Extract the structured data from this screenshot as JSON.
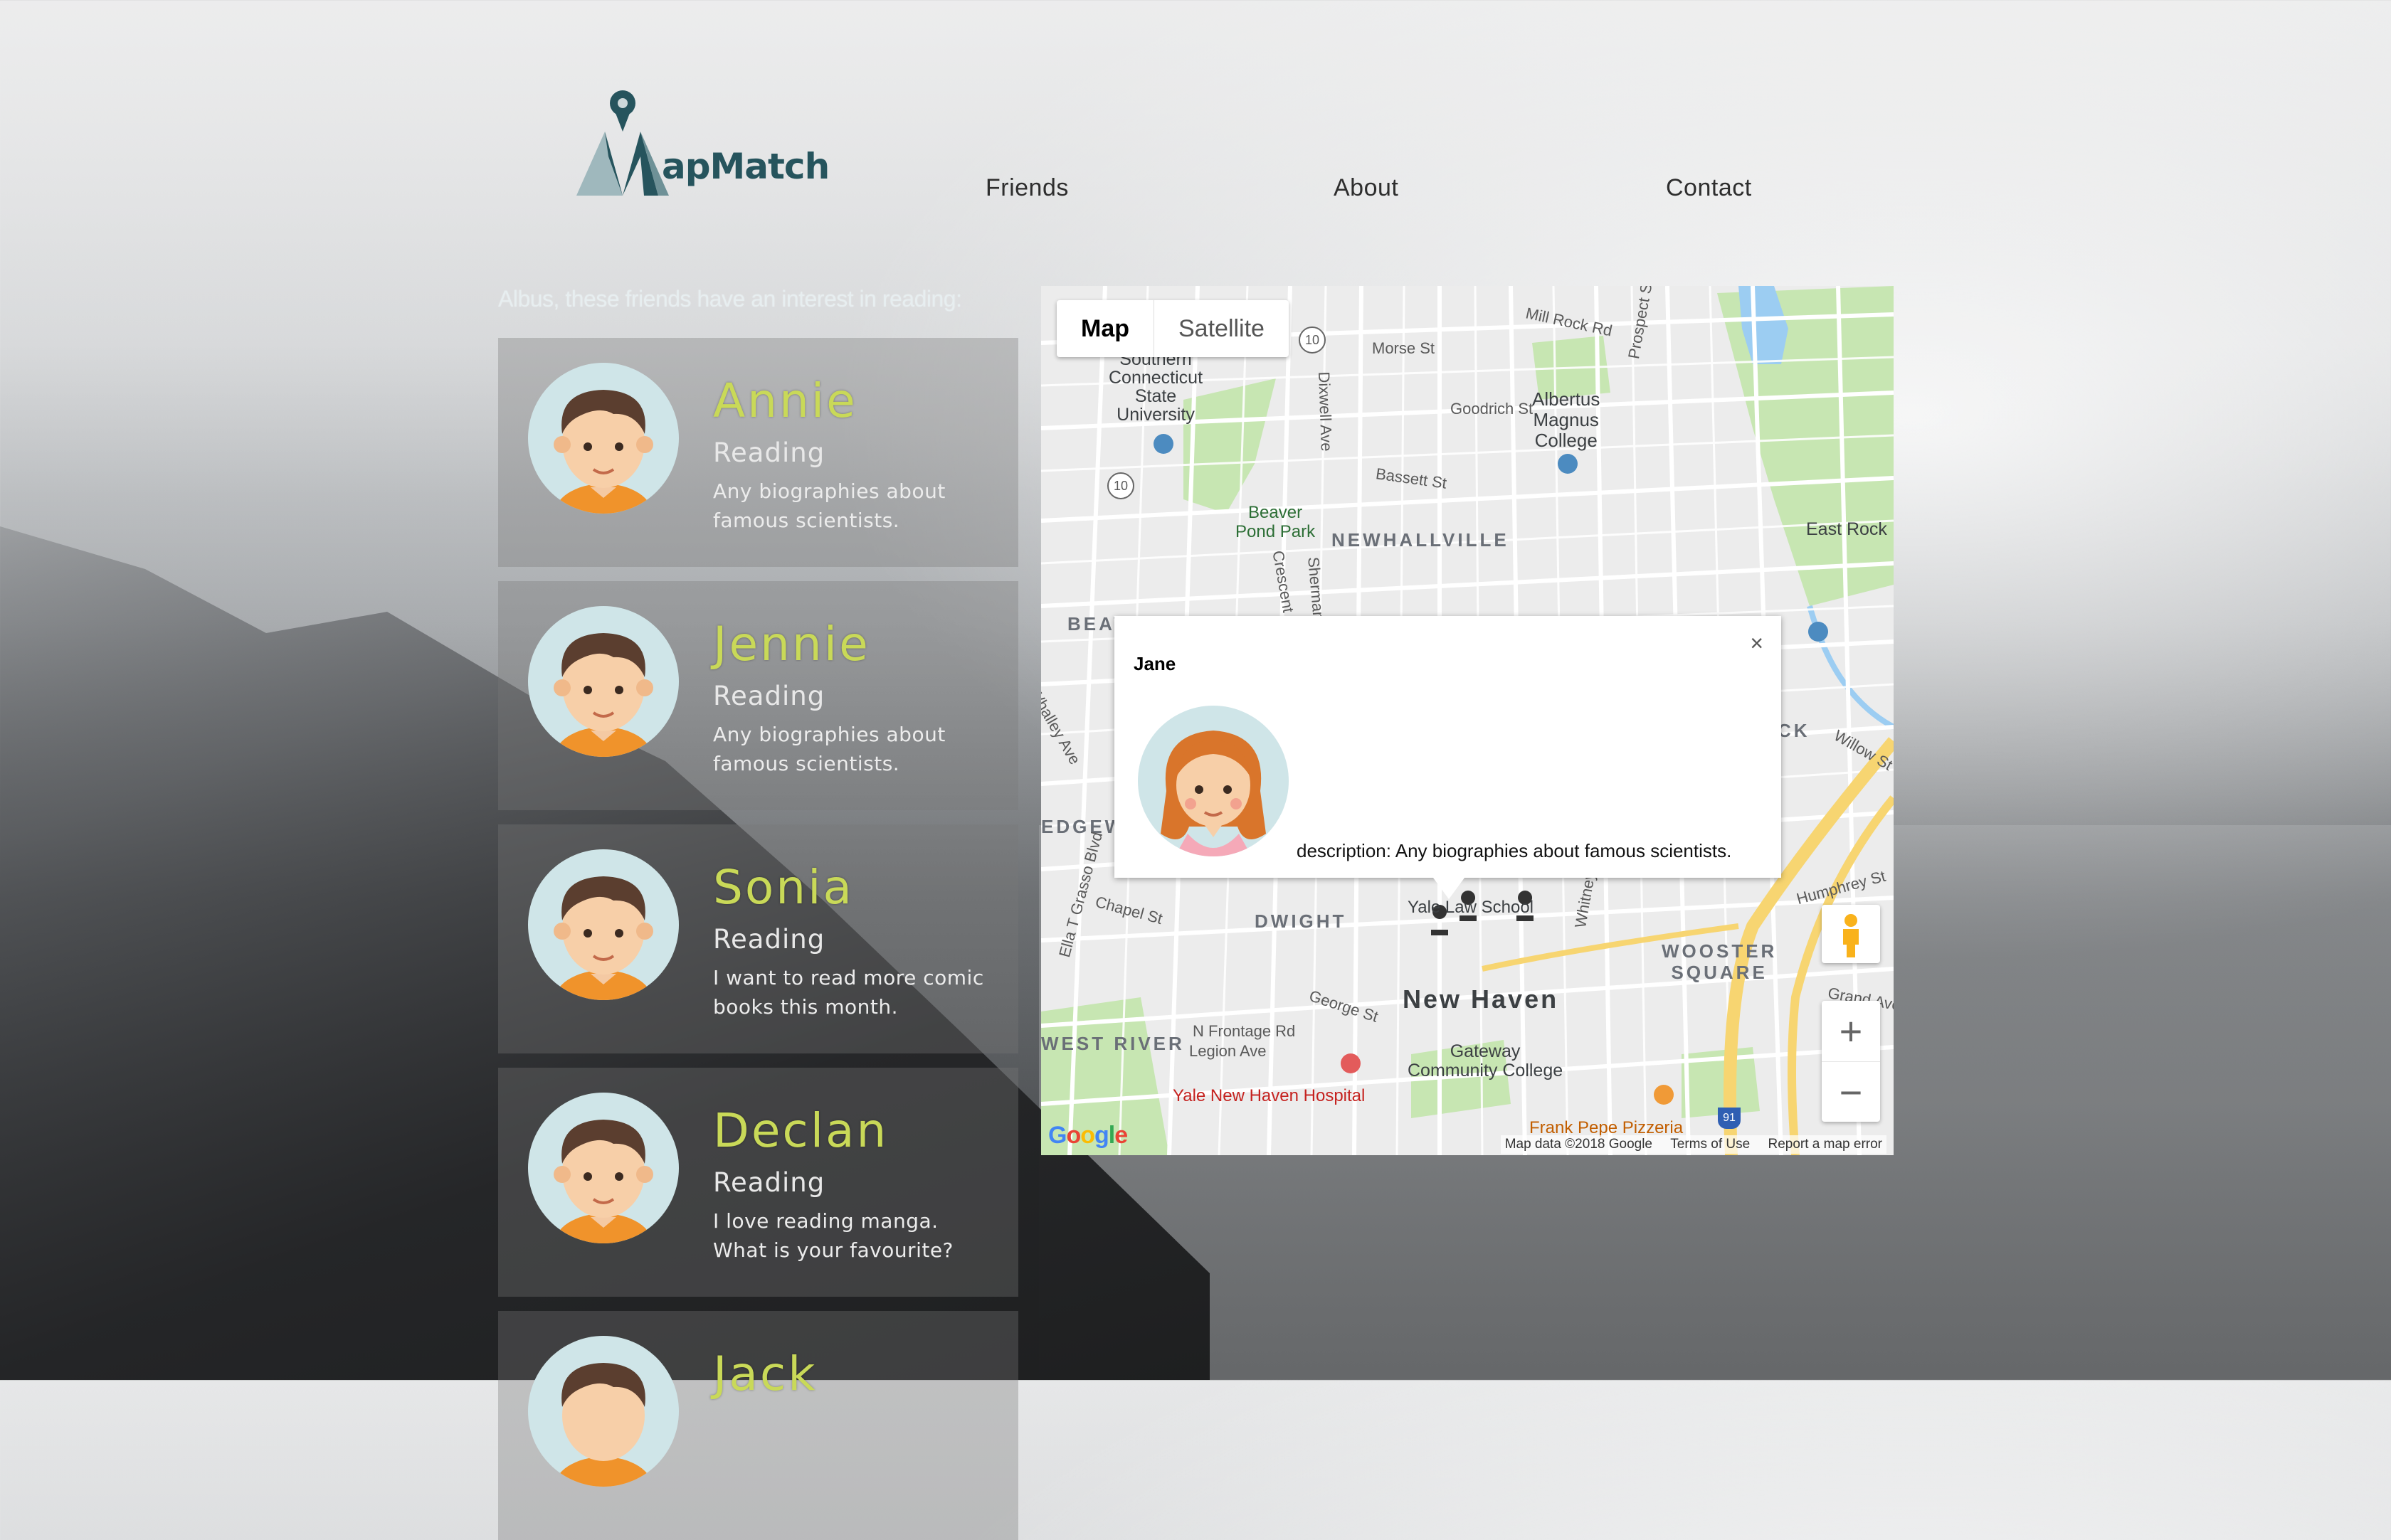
{
  "header": {
    "logo_text": "apMatch",
    "nav": [
      "Friends",
      "About",
      "Contact"
    ]
  },
  "intro": "Albus, these friends have an interest in reading:",
  "friends": [
    {
      "name": "Annie",
      "interest": "Reading",
      "description": "Any biographies about famous scientists."
    },
    {
      "name": "Jennie",
      "interest": "Reading",
      "description": "Any biographies about famous scientists."
    },
    {
      "name": "Sonia",
      "interest": "Reading",
      "description": "I want to read more comic books this month."
    },
    {
      "name": "Declan",
      "interest": "Reading",
      "description": "I love reading manga. What is your favourite?"
    },
    {
      "name": "Jack",
      "interest": "",
      "description": ""
    }
  ],
  "map": {
    "type_buttons": [
      "Map",
      "Satellite"
    ],
    "active_type": "Map",
    "zoom_in": "+",
    "zoom_out": "−",
    "google": "Google",
    "attribution": [
      "Map data ©2018 Google",
      "Terms of Use",
      "Report a map error"
    ],
    "labels": {
      "newhallville": "NEWHALLVILLE",
      "new_haven": "New Haven",
      "dwight": "DWIGHT",
      "wooster_square": "WOOSTER\nSQUARE",
      "west_river": "WEST RIVER",
      "beaver": "BEAVER HILLS",
      "edgewood": "EDGEW",
      "east_rock_nb": "CK",
      "east_rock": "East Rock",
      "southern_ct": "Southern\nConnecticut\nState\nUniversity",
      "albertus": "Albertus\nMagnus\nCollege",
      "beaver_pond": "Beaver\nPond Park",
      "gateway": "Gateway\nCommunity College",
      "yale_hospital": "Yale New Haven Hospital",
      "frank_pepe": "Frank Pepe Pizzeria",
      "yale_school": "Yale Law School",
      "morse": "Morse St",
      "mill_rock": "Mill Rock Rd",
      "goodrich": "Goodrich St",
      "bassett": "Bassett St",
      "dixwell": "Dixwell Ave",
      "prospect": "Prospect St",
      "chapel": "Chapel St",
      "george": "George St",
      "n_frontage": "N Frontage Rd",
      "legion": "Legion Ave",
      "humphrey": "Humphrey St",
      "grand": "Grand Ave",
      "willow": "Willow St",
      "whalley": "Whalley Ave",
      "ella": "Ella T Grasso Blvd",
      "whitney": "Whitney",
      "sherman": "Sherman Pkwy",
      "crescent": "Crescent St",
      "rt10": "10",
      "i91": "91"
    }
  },
  "info_window": {
    "title": "Jane",
    "close": "×",
    "description": "description: Any biographies about famous scientists."
  },
  "colors": {
    "logo": "#26545d",
    "name_accent": "#c9d958",
    "avatar_bg": "#cfe5e8",
    "map_road": "#ffffff",
    "map_park": "#c7e6b2",
    "map_highway": "#f7d571",
    "map_water": "#9ccdf2"
  }
}
